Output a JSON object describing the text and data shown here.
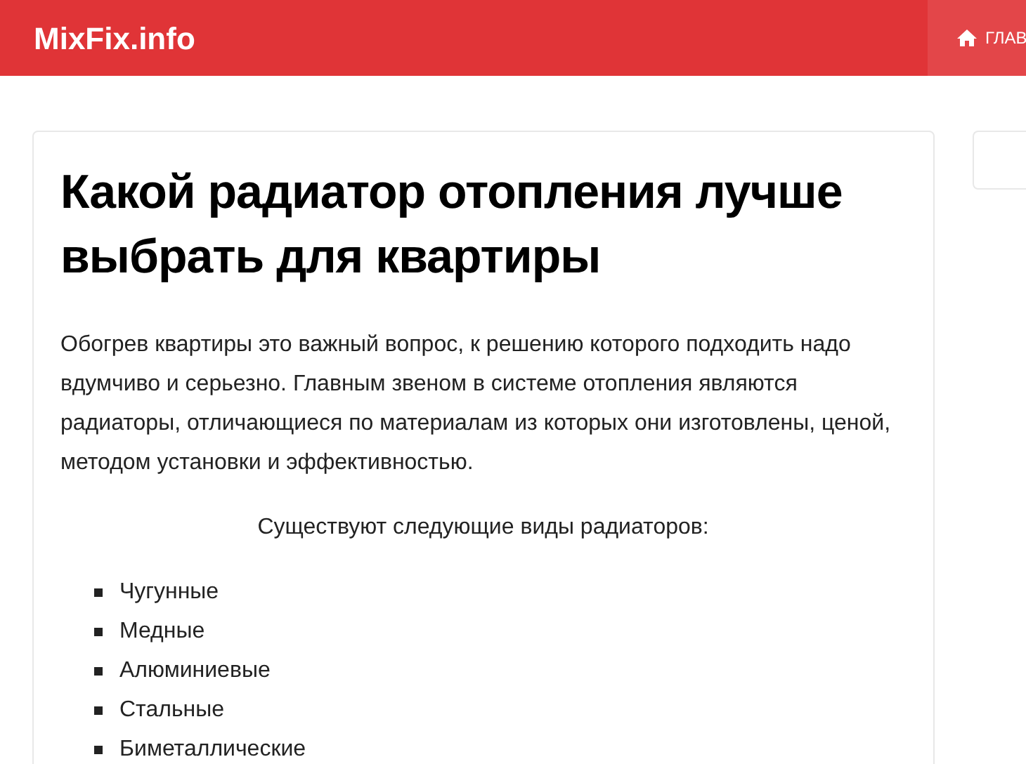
{
  "header": {
    "logo": "MixFix.info",
    "nav": [
      {
        "label": "ГЛАВ",
        "selected": true
      }
    ]
  },
  "article": {
    "title": "Какой радиатор отопления лучше выбрать для квартиры",
    "intro": "Обогрев квартиры это важный вопрос, к решению которого подходить надо вдумчиво и серьезно. Главным звеном в системе отопления являются радиаторы, отличающиеся по материалам из которых они изготовлены, ценой, методом установки и эффективностью.",
    "lead": "Существуют следующие виды радиаторов:",
    "items": [
      "Чугунные",
      "Медные",
      "Алюминиевые",
      "Стальные",
      "Биметаллические"
    ]
  }
}
